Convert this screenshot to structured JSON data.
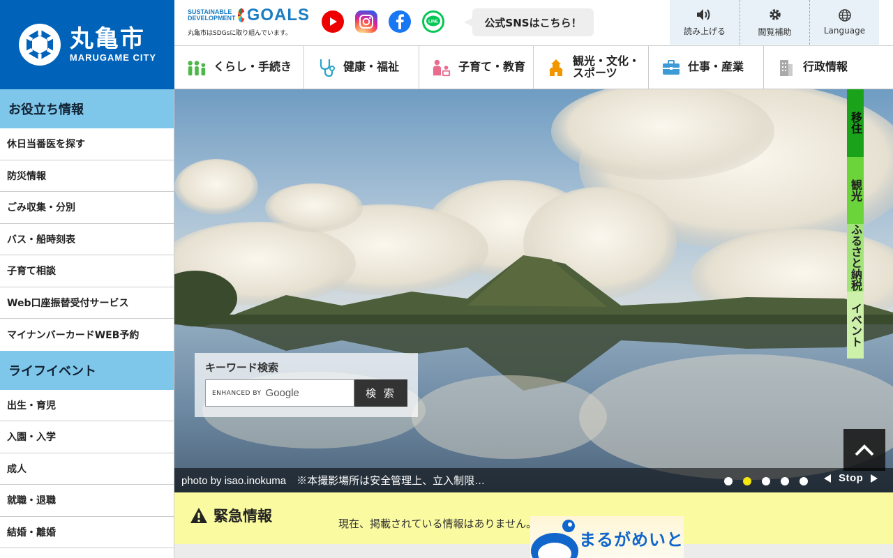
{
  "logo": {
    "name_jp": "丸亀市",
    "name_en": "MARUGAME CITY"
  },
  "sdgs": {
    "line1": "SUSTAINABLE",
    "line2": "DEVELOPMENT",
    "goals": "GOALS",
    "note": "丸亀市はSDGsに取り組んでいます。"
  },
  "sns": {
    "callout": "公式SNSはこちら！",
    "icons": [
      "youtube-icon",
      "instagram-icon",
      "facebook-icon",
      "line-icon"
    ]
  },
  "tools": [
    {
      "label": "読み上げる",
      "icon": "speaker-icon"
    },
    {
      "label": "閲覧補助",
      "icon": "gear-icon"
    },
    {
      "label": "Language",
      "icon": "globe-icon"
    }
  ],
  "nav": [
    {
      "label": "くらし・手続き",
      "icon": "people-icon"
    },
    {
      "label": "健康・福祉",
      "icon": "stethoscope-icon"
    },
    {
      "label": "子育て・教育",
      "icon": "family-icon"
    },
    {
      "label": "観光・文化・スポーツ",
      "label_l1": "観光・文化・",
      "label_l2": "スポーツ",
      "icon": "castle-icon"
    },
    {
      "label": "仕事・産業",
      "icon": "briefcase-icon"
    },
    {
      "label": "行政情報",
      "icon": "building-icon"
    }
  ],
  "sidebar": {
    "useful_title": "お役立ち情報",
    "useful": [
      "休日当番医を探す",
      "防災情報",
      "ごみ収集・分別",
      "バス・船時刻表",
      "子育て相談",
      "Web口座振替受付サービス",
      "マイナンバーカードWEB予約"
    ],
    "life_title": "ライフイベント",
    "life": [
      "出生・育児",
      "入園・入学",
      "成人",
      "就職・退職",
      "結婚・離婚"
    ]
  },
  "search": {
    "label": "キーワード検索",
    "enhanced": "ENHANCED BY",
    "google": "Google",
    "button": "検 索"
  },
  "side_tabs": [
    "移住",
    "観光",
    "ふるさと納税",
    "イベント"
  ],
  "slider": {
    "caption": "photo by isao.inokuma　※本撮影場所は安全管理上、立入制限…",
    "dots": 5,
    "active_dot": 2,
    "stop_label": "Stop"
  },
  "emergency": {
    "title": "緊急情報",
    "text": "現在、掲載されている情報はありません。"
  },
  "banner": {
    "text": "まるがめいと"
  },
  "colors": {
    "brand_blue": "#0062b8",
    "sidebar_head": "#7ec6ea",
    "emergency_bg": "#fafaa0",
    "active_dot": "#f4e60e"
  }
}
